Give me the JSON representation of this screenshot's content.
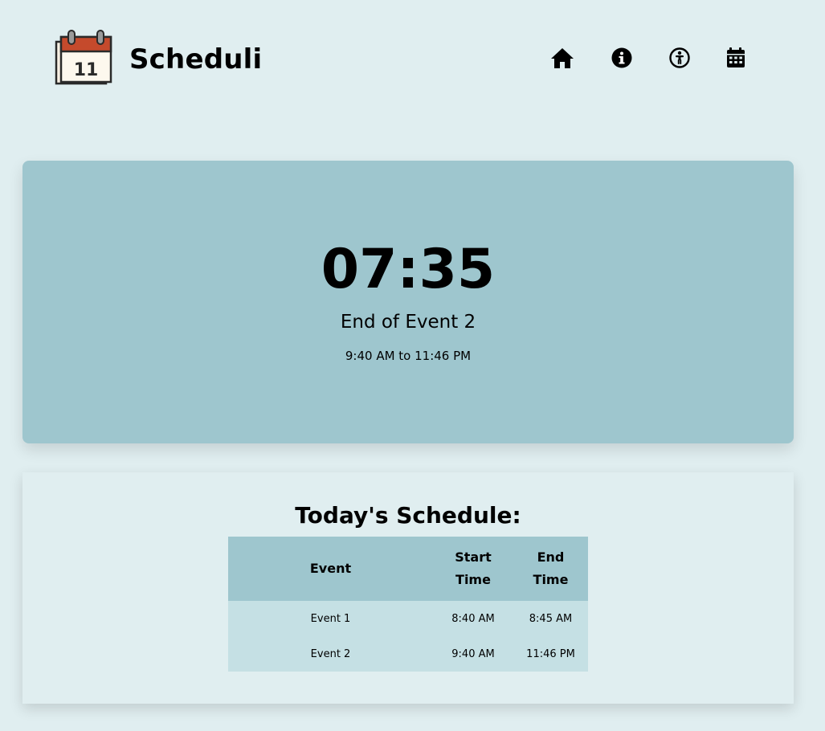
{
  "app": {
    "name": "Scheduli",
    "logo_icon": "calendar-11-icon",
    "logo_day": "11"
  },
  "nav": [
    {
      "icon": "home-icon",
      "label": "Home"
    },
    {
      "icon": "info-icon",
      "label": "About"
    },
    {
      "icon": "accessibility-icon",
      "label": "Accessibility"
    },
    {
      "icon": "calendar-icon",
      "label": "Schedule"
    }
  ],
  "timer": {
    "countdown": "07:35",
    "event_label": "End of Event 2",
    "event_range": "9:40 AM to 11:46 PM"
  },
  "schedule": {
    "title": "Today's Schedule:",
    "columns": {
      "event": "Event",
      "start": "Start Time",
      "end": "End Time"
    },
    "rows": [
      {
        "event": "Event 1",
        "start": "8:40 AM",
        "end": "8:45 AM"
      },
      {
        "event": "Event 2",
        "start": "9:40 AM",
        "end": "11:46 PM"
      }
    ]
  },
  "colors": {
    "background": "#e0eef0",
    "card": "#9ec6ce",
    "table_body": "#c5e0e4",
    "logo_red": "#c54a2c"
  }
}
